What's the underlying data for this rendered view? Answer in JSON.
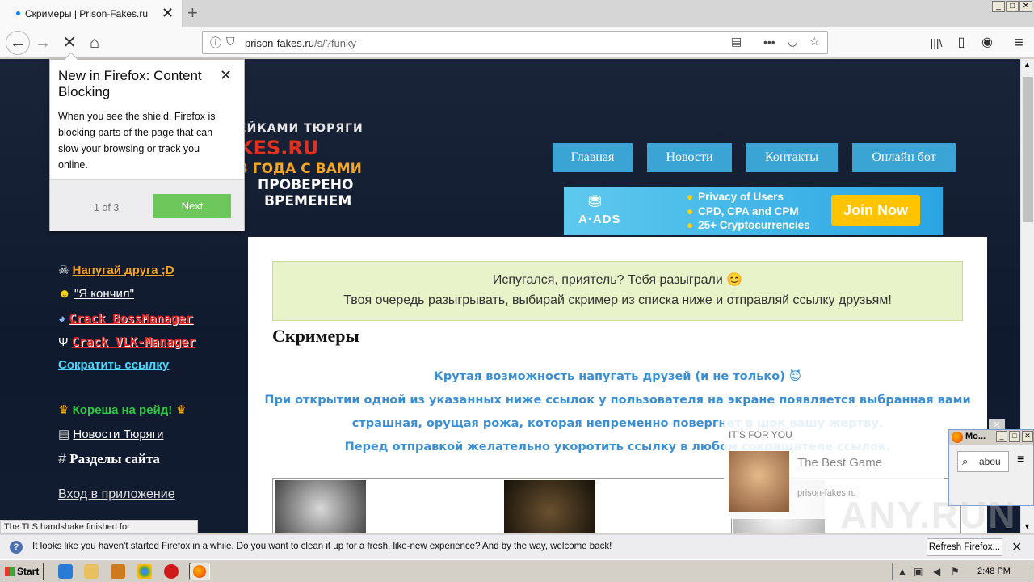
{
  "window": {
    "tab_title": "Скримеры | Prison-Fakes.ru",
    "tab_close": "✕",
    "new_tab": "+",
    "min": "_",
    "max": "□",
    "close": "✕"
  },
  "nav": {
    "back": "←",
    "forward": "→",
    "stop": "✕",
    "home": "⌂",
    "url_domain": "prison-fakes.ru",
    "url_path": "/s/?funky",
    "page_actions": "•••",
    "library": "|||\\",
    "sidebar": "▯",
    "account": "◉",
    "menu": "≡"
  },
  "logo": {
    "line1": "ЕЙКАМИ ТЮРЯГИ",
    "line2": "KES.RU",
    "line3": "3 ГОДА С ВАМИ",
    "line4": "ПРОВЕРЕНО",
    "line5": "ВРЕМЕНЕМ"
  },
  "topnav": [
    "Главная",
    "Новости",
    "Контакты",
    "Онлайн бот"
  ],
  "ad": {
    "brand": "A·ADS",
    "lines": [
      "Privacy of Users",
      "CPD, CPA and CPM",
      "25+ Cryptocurrencies"
    ],
    "bullet": "●",
    "cta": "Join Now"
  },
  "sidebar": {
    "items": [
      {
        "icon": "☠",
        "label": "Напугай друга ;D"
      },
      {
        "icon": "☻",
        "label": "\"Я кончил\""
      },
      {
        "icon": "◕",
        "label": "Crack BossManager"
      },
      {
        "icon": "Ψ",
        "label": "Crack VLK-Manager"
      },
      {
        "label": "Сократить ссылку"
      },
      {
        "icon": "♛",
        "label": "Кореша на рейд!",
        "icon_after": "♛"
      },
      {
        "icon": "▤",
        "label": "Новости Тюряги"
      },
      {
        "icon": "#",
        "label": "Разделы сайта"
      },
      {
        "label": "Вход в приложение"
      }
    ]
  },
  "main": {
    "notice_line1": "Испугался, приятель? Тебя разыграли 😊",
    "notice_line2": "Твоя очередь разыгрывать, выбирай скример из списка ниже и отправляй ссылку друзьям!",
    "heading": "Скримеры",
    "desc": [
      "Крутая возможность напугать друзей (и не только) 😈",
      "При открытии одной из указанных ниже ссылок у пользователя на экране появляется выбранная вами",
      "страшная, орущая рожа, которая непременно повергнет в шок вашу жертву.",
      "Перед отправкой желательно укоротить ссылку в любом сокращателе ссылок."
    ]
  },
  "popup": {
    "title": "New in Firefox: Content Blocking",
    "body": "When you see the shield, Firefox is blocking parts of the page that can slow your browsing or track you online.",
    "close": "✕",
    "step": "1 of 3",
    "next": "Next"
  },
  "overlay_ad": {
    "tag": "IT'S FOR YOU",
    "title": "The Best Game",
    "site": "prison-fakes.ru",
    "close": "✕"
  },
  "miniwin": {
    "title": "Mo...",
    "search": "abou",
    "menu": "≡"
  },
  "status": "The TLS handshake finished for mc.yandex.md...",
  "notification": {
    "icon": "?",
    "message": "It looks like you haven't started Firefox in a while. Do you want to clean it up for a fresh, like-new experience? And by the way, welcome back!",
    "button": "Refresh Firefox...",
    "close": "✕"
  },
  "taskbar": {
    "start": "Start",
    "clock": "2:48 PM"
  },
  "watermark": "ANY.RUN",
  "colors": {
    "topnav_bg": "#3aa4d4",
    "sidebar_orange": "#f5a623",
    "sidebar_red": "#e02020",
    "sidebar_cyan": "#4dd8ff",
    "sidebar_green": "#2ecc40",
    "desc_blue": "#3a8fd4",
    "next_green": "#6ec75a"
  }
}
